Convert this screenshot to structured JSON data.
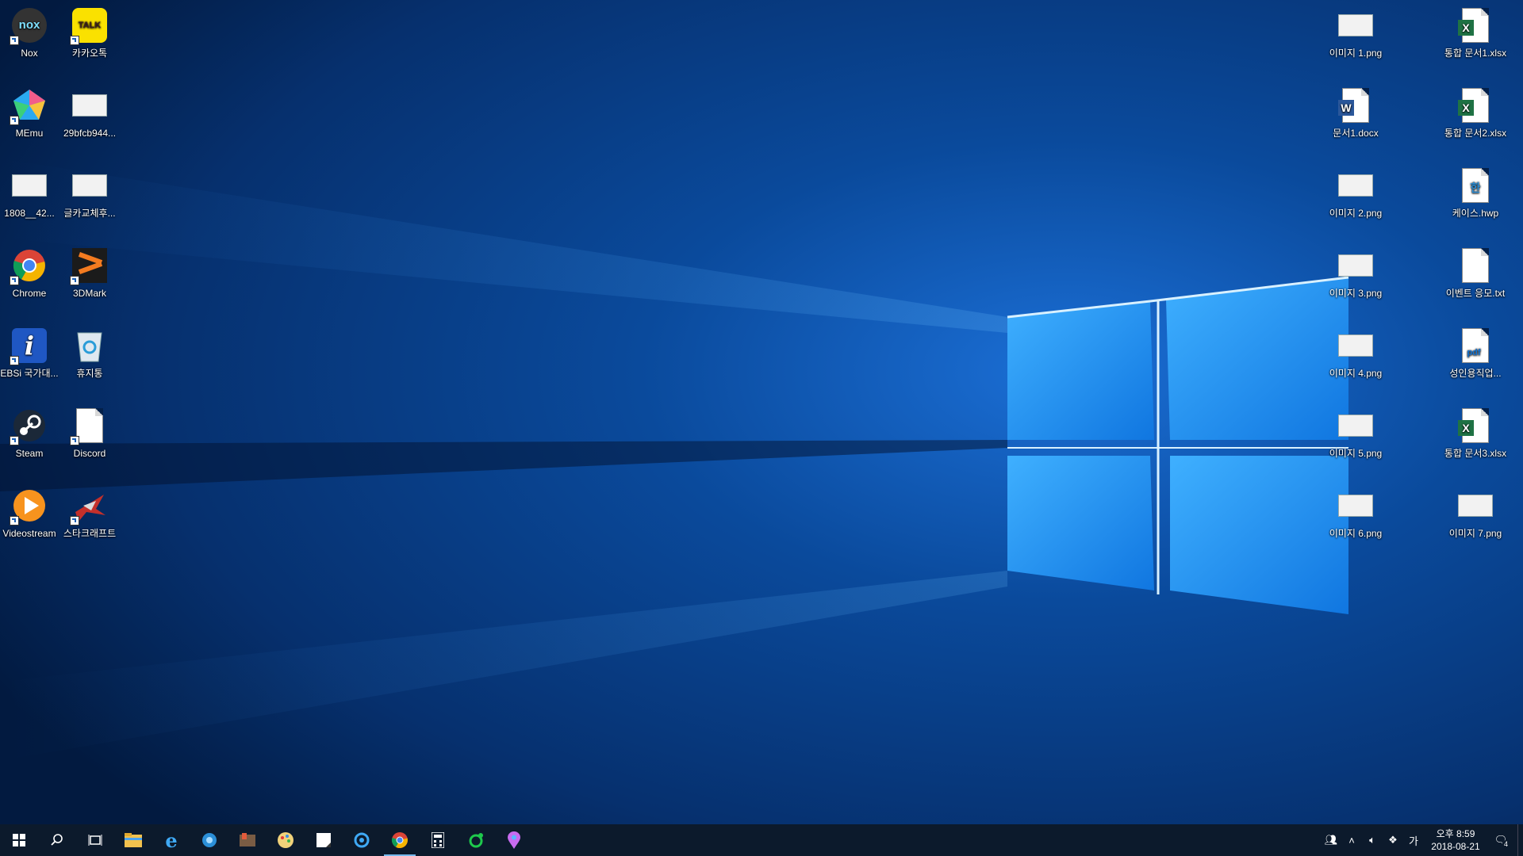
{
  "desktop_left": [
    {
      "name": "Nox",
      "icon": "nox-icon"
    },
    {
      "name": "카카오톡",
      "icon": "kakaotalk-icon",
      "badge": "TALK"
    },
    {
      "name": "MEmu",
      "icon": "memu-icon"
    },
    {
      "name": "29bfcb944...",
      "icon": "image-thumbnail-icon"
    },
    {
      "name": "1808__42...",
      "icon": "image-thumbnail-icon"
    },
    {
      "name": "글카교체후...",
      "icon": "image-thumbnail-icon"
    },
    {
      "name": "Chrome",
      "icon": "chrome-icon"
    },
    {
      "name": "3DMark",
      "icon": "3dmark-icon"
    },
    {
      "name": "EBSi 국가대...",
      "icon": "ebsi-icon",
      "badge": "i"
    },
    {
      "name": "휴지통",
      "icon": "recycle-bin-icon"
    },
    {
      "name": "Steam",
      "icon": "steam-icon"
    },
    {
      "name": "Discord",
      "icon": "discord-file-icon"
    },
    {
      "name": "Videostream",
      "icon": "videostream-icon"
    },
    {
      "name": "스타크래프트",
      "icon": "starcraft-icon"
    }
  ],
  "desktop_right": [
    {
      "name": "이미지 1.png",
      "icon": "image-thumbnail-icon"
    },
    {
      "name": "통합 문서1.xlsx",
      "icon": "excel-icon",
      "badge": "X"
    },
    {
      "name": "문서1.docx",
      "icon": "word-icon",
      "badge": "W"
    },
    {
      "name": "통합 문서2.xlsx",
      "icon": "excel-icon",
      "badge": "X"
    },
    {
      "name": "이미지 2.png",
      "icon": "image-thumbnail-icon"
    },
    {
      "name": "케이스.hwp",
      "icon": "hwp-icon",
      "badge": "한"
    },
    {
      "name": "이미지 3.png",
      "icon": "image-thumbnail-icon"
    },
    {
      "name": "이벤트 응모.txt",
      "icon": "text-file-icon"
    },
    {
      "name": "이미지 4.png",
      "icon": "image-thumbnail-icon"
    },
    {
      "name": "성인용직업...",
      "icon": "pdf-icon",
      "badge": "pdf"
    },
    {
      "name": "이미지 5.png",
      "icon": "image-thumbnail-icon"
    },
    {
      "name": "통합 문서3.xlsx",
      "icon": "excel-icon",
      "badge": "X"
    },
    {
      "name": "이미지 6.png",
      "icon": "image-thumbnail-icon"
    },
    {
      "name": "이미지 7.png",
      "icon": "image-thumbnail-icon"
    }
  ],
  "taskbar": {
    "apps": [
      "start-icon",
      "search-icon",
      "task-view-icon",
      "file-explorer-icon",
      "internet-explorer-icon",
      "edge-legacy-icon",
      "app-icon",
      "paint-icon",
      "sticky-notes-icon",
      "refresh-browser-icon",
      "chrome-icon",
      "calculator-icon",
      "green-app-icon",
      "maps-icon"
    ],
    "tray": {
      "ime": "가",
      "time": "오후 8:59",
      "date": "2018-08-21",
      "notifications": "4"
    }
  },
  "colors": {
    "accent": "#1a9cff",
    "taskbar": "#0c1a2c",
    "excel": "#1f7244",
    "word": "#2b579a",
    "pdf": "#1173d4"
  }
}
